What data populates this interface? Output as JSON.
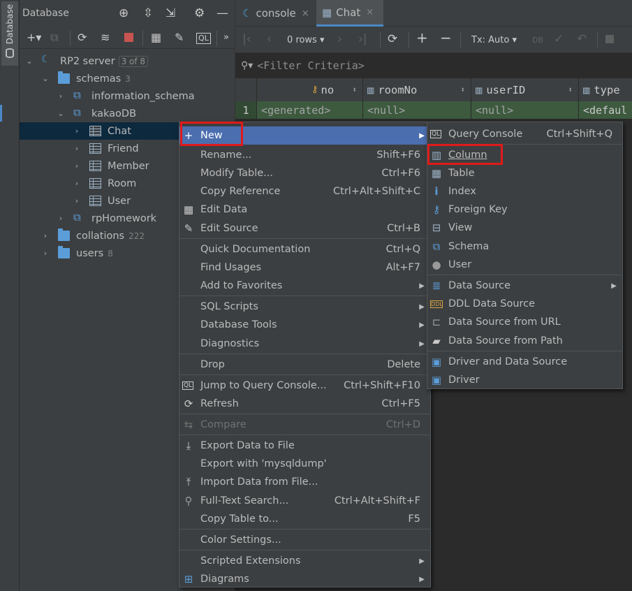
{
  "strip": {
    "tab_label": "Database",
    "icon": "database-icon"
  },
  "db_panel": {
    "title": "Database",
    "header_icons": [
      "crosshair-icon",
      "expand-all-icon",
      "collapse-all-icon",
      "gear-icon",
      "minimize-icon"
    ],
    "toolbar_icons": [
      "add-icon",
      "duplicate-icon",
      "refresh-icon",
      "properties-icon",
      "stop-icon",
      "table-editor-icon",
      "edit-icon",
      "query-console-icon",
      "more-icon"
    ]
  },
  "tree": {
    "server": {
      "label": "RP2 server",
      "badge": "3 of 8"
    },
    "schemas": {
      "label": "schemas",
      "count": "3"
    },
    "information_schema": "information_schema",
    "kakaodb": "kakaoDB",
    "tables": [
      "Chat",
      "Friend",
      "Member",
      "Room",
      "User"
    ],
    "rphomework": "rpHomework",
    "collations": {
      "label": "collations",
      "count": "222"
    },
    "users": {
      "label": "users",
      "count": "8"
    }
  },
  "editor": {
    "tabs": [
      {
        "label": "console",
        "close": "×"
      },
      {
        "label": "Chat",
        "close": "×"
      }
    ],
    "rows_label": "0 rows",
    "tx_label": "Tx: Auto",
    "filter_placeholder": "<Filter Criteria>",
    "columns": [
      "no",
      "roomNo",
      "userID",
      "type"
    ],
    "row_number": "1",
    "row_values": [
      "<generated>",
      "<null>",
      "<null>",
      "<defaul"
    ]
  },
  "context_menu": {
    "items": [
      {
        "label": "New",
        "shortcut": "",
        "submenu": true,
        "icon": "plus-icon",
        "highlighted": true
      },
      {
        "label": "Rename...",
        "shortcut": "Shift+F6"
      },
      {
        "label": "Modify Table...",
        "shortcut": "Ctrl+F6"
      },
      {
        "label": "Copy Reference",
        "shortcut": "Ctrl+Alt+Shift+C"
      },
      {
        "label": "Edit Data",
        "shortcut": "",
        "icon": "table-icon"
      },
      {
        "label": "Edit Source",
        "shortcut": "Ctrl+B",
        "icon": "pencil-icon"
      },
      {
        "label": "Quick Documentation",
        "shortcut": "Ctrl+Q"
      },
      {
        "label": "Find Usages",
        "shortcut": "Alt+F7"
      },
      {
        "label": "Add to Favorites",
        "shortcut": "",
        "submenu": true
      },
      {
        "label": "SQL Scripts",
        "shortcut": "",
        "submenu": true
      },
      {
        "label": "Database Tools",
        "shortcut": "",
        "submenu": true
      },
      {
        "label": "Diagnostics",
        "shortcut": "",
        "submenu": true
      },
      {
        "label": "Drop",
        "shortcut": "Delete"
      },
      {
        "label": "Jump to Query Console...",
        "shortcut": "Ctrl+Shift+F10",
        "icon": "query-console-icon"
      },
      {
        "label": "Refresh",
        "shortcut": "Ctrl+F5",
        "icon": "refresh-icon"
      },
      {
        "label": "Compare",
        "shortcut": "Ctrl+D",
        "icon": "compare-icon",
        "disabled": true
      },
      {
        "label": "Export Data to File",
        "shortcut": "",
        "icon": "export-icon"
      },
      {
        "label": "Export with 'mysqldump'",
        "shortcut": ""
      },
      {
        "label": "Import Data from File...",
        "shortcut": "",
        "icon": "import-icon"
      },
      {
        "label": "Full-Text Search...",
        "shortcut": "Ctrl+Alt+Shift+F",
        "icon": "search-icon"
      },
      {
        "label": "Copy Table to...",
        "shortcut": "F5"
      },
      {
        "label": "Color Settings...",
        "shortcut": ""
      },
      {
        "label": "Scripted Extensions",
        "shortcut": "",
        "submenu": true
      },
      {
        "label": "Diagrams",
        "shortcut": "",
        "submenu": true,
        "icon": "diagram-icon"
      }
    ]
  },
  "submenu": {
    "items": [
      {
        "label": "Query Console",
        "shortcut": "Ctrl+Shift+Q",
        "icon": "query-console-icon"
      },
      {
        "label": "Column",
        "icon": "column-icon"
      },
      {
        "label": "Table",
        "icon": "table-icon"
      },
      {
        "label": "Index",
        "icon": "index-icon"
      },
      {
        "label": "Foreign Key",
        "icon": "key-icon"
      },
      {
        "label": "View",
        "icon": "view-icon"
      },
      {
        "label": "Schema",
        "icon": "schema-icon"
      },
      {
        "label": "User",
        "icon": "user-icon"
      },
      {
        "label": "Data Source",
        "icon": "datasource-icon",
        "submenu": true
      },
      {
        "label": "DDL Data Source",
        "icon": "ddl-icon"
      },
      {
        "label": "Data Source from URL",
        "icon": "url-icon"
      },
      {
        "label": "Data Source from Path",
        "icon": "folder-icon"
      },
      {
        "label": "Driver and Data Source",
        "icon": "driver-icon"
      },
      {
        "label": "Driver",
        "icon": "driver-icon"
      }
    ]
  },
  "colors": {
    "highlight": "#4b6eaf",
    "annotation": "#e01a1a",
    "selection": "#0d293e",
    "new_row": "#3d5a3f"
  }
}
